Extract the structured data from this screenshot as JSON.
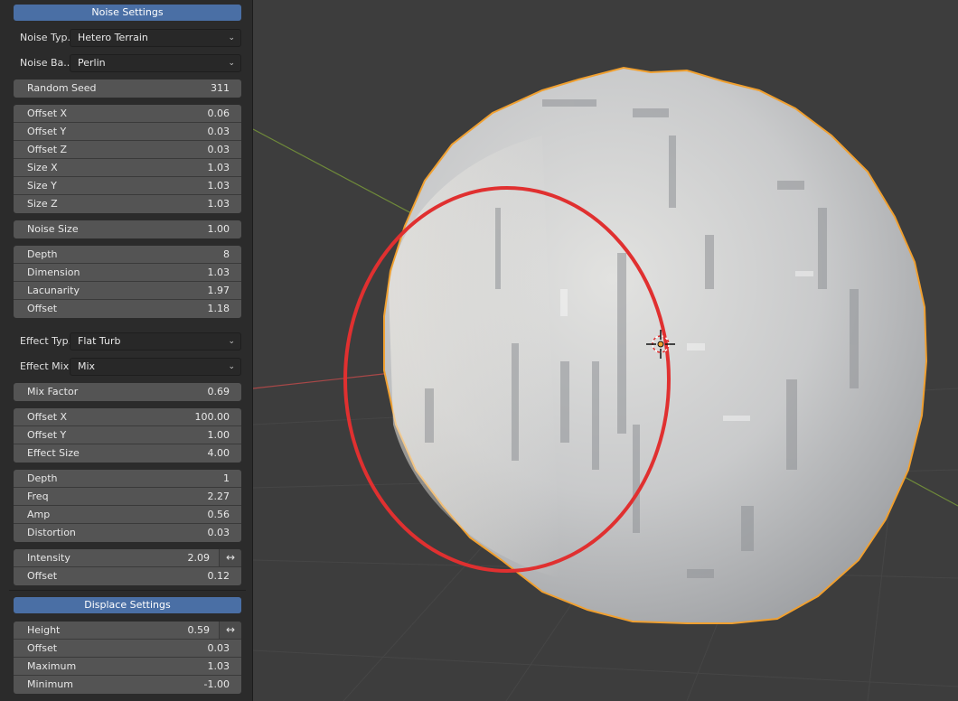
{
  "noise_panel": {
    "header": "Noise Settings",
    "noise_type_label": "Noise Typ..",
    "noise_type_value": "Hetero Terrain",
    "noise_basis_label": "Noise Ba..",
    "noise_basis_value": "Perlin",
    "random_seed": {
      "label": "Random Seed",
      "value": "311"
    },
    "offset_size": [
      {
        "label": "Offset X",
        "value": "0.06"
      },
      {
        "label": "Offset Y",
        "value": "0.03"
      },
      {
        "label": "Offset Z",
        "value": "0.03"
      },
      {
        "label": "Size X",
        "value": "1.03"
      },
      {
        "label": "Size Y",
        "value": "1.03"
      },
      {
        "label": "Size Z",
        "value": "1.03"
      }
    ],
    "noise_size": {
      "label": "Noise Size",
      "value": "1.00"
    },
    "fractal": [
      {
        "label": "Depth",
        "value": "8"
      },
      {
        "label": "Dimension",
        "value": "1.03"
      },
      {
        "label": "Lacunarity",
        "value": "1.97"
      },
      {
        "label": "Offset",
        "value": "1.18"
      }
    ],
    "effect_type_label": "Effect Typ..",
    "effect_type_value": "Flat Turb",
    "effect_mix_label": "Effect Mix:",
    "effect_mix_value": "Mix",
    "mix_factor": {
      "label": "Mix Factor",
      "value": "0.69"
    },
    "effect_offset": [
      {
        "label": "Offset X",
        "value": "100.00"
      },
      {
        "label": "Offset Y",
        "value": "1.00"
      },
      {
        "label": "Effect Size",
        "value": "4.00"
      }
    ],
    "effect_params": [
      {
        "label": "Depth",
        "value": "1"
      },
      {
        "label": "Freq",
        "value": "2.27"
      },
      {
        "label": "Amp",
        "value": "0.56"
      },
      {
        "label": "Distortion",
        "value": "0.03"
      }
    ],
    "intensity": {
      "label": "Intensity",
      "value": "2.09"
    },
    "intensity_offset": {
      "label": "Offset",
      "value": "0.12"
    }
  },
  "displace_panel": {
    "header": "Displace Settings",
    "height": {
      "label": "Height",
      "value": "0.59"
    },
    "rows": [
      {
        "label": "Offset",
        "value": "0.03"
      },
      {
        "label": "Maximum",
        "value": "1.03"
      },
      {
        "label": "Minimum",
        "value": "-1.00"
      }
    ]
  },
  "icons": {
    "dropdown": "chevron-down-icon",
    "swap": "swap-arrows-icon",
    "cursor": "3d-cursor-icon"
  },
  "colors": {
    "panel_header": "#4a6fa5",
    "annotation_circle": "#e03030",
    "selection_outline": "#f0a030",
    "x_axis": "#a84848",
    "y_axis": "#6f8a3a"
  }
}
